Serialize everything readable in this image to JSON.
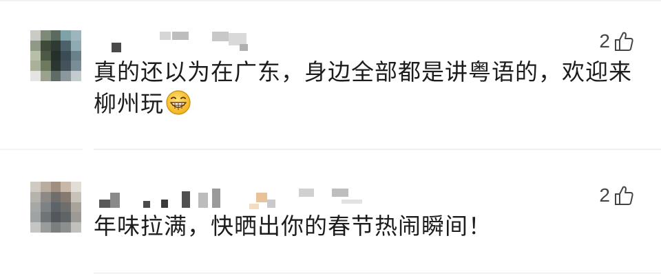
{
  "comments": [
    {
      "text": "真的还以为在广东，身边全部都是讲粤语的，欢迎来柳州玩",
      "emoji": "grinning-face-emoji",
      "like_count": "2",
      "like_icon": "thumbs-up-icon"
    },
    {
      "text": "年味拉满，快晒出你的春节热闹瞬间！",
      "like_count": "2",
      "like_icon": "thumbs-up-icon"
    }
  ]
}
